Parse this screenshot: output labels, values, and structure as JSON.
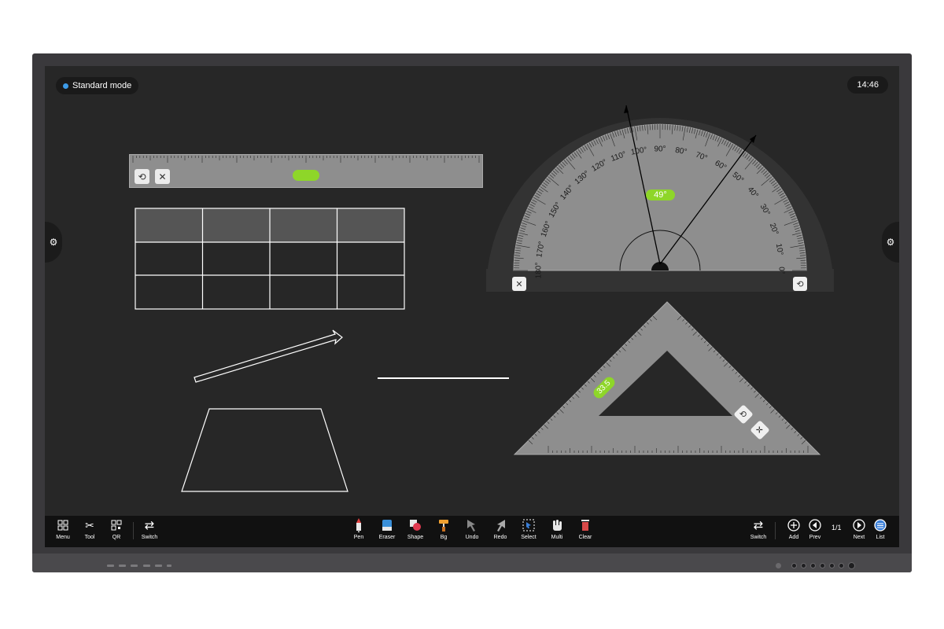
{
  "status": {
    "mode_label": "Standard mode",
    "clock": "14:46"
  },
  "ruler": {
    "angle_tag": ""
  },
  "protractor": {
    "angle_tag": "49°",
    "left_labels": [
      "180°",
      "170°",
      "160°",
      "150°",
      "140°",
      "130°",
      "120°",
      "110°",
      "100°"
    ],
    "right_labels": [
      "90°",
      "80°",
      "70°",
      "60°",
      "50°",
      "40°",
      "30°",
      "20°",
      "10°",
      "0°"
    ]
  },
  "set_square": {
    "angle_tag": "33.5"
  },
  "toolbar": {
    "left": [
      {
        "label": "Menu",
        "icon": "menu-grid-icon"
      },
      {
        "label": "Tool",
        "icon": "tools-icon"
      },
      {
        "label": "QR",
        "icon": "qr-code-icon"
      },
      {
        "label": "Switch",
        "icon": "switch-icon"
      }
    ],
    "center": [
      {
        "label": "Pen",
        "icon": "pen-icon"
      },
      {
        "label": "Eraser",
        "icon": "eraser-icon"
      },
      {
        "label": "Shape",
        "icon": "shape-icon"
      },
      {
        "label": "Bg",
        "icon": "background-brush-icon"
      },
      {
        "label": "Undo",
        "icon": "undo-icon"
      },
      {
        "label": "Redo",
        "icon": "redo-icon"
      },
      {
        "label": "Select",
        "icon": "select-icon"
      },
      {
        "label": "Multi",
        "icon": "multi-touch-icon"
      },
      {
        "label": "Clear",
        "icon": "clear-icon"
      }
    ],
    "right": [
      {
        "label": "Switch",
        "icon": "switch-icon"
      },
      {
        "label": "Add",
        "icon": "add-page-icon"
      },
      {
        "label": "Prev",
        "icon": "prev-page-icon"
      },
      {
        "label": "Next",
        "icon": "next-page-icon"
      },
      {
        "label": "List",
        "icon": "page-list-icon"
      }
    ],
    "page_indicator": "1/1"
  },
  "colors": {
    "accent_green": "#8ed629",
    "mode_dot": "#3d9be9",
    "board": "#272727"
  }
}
